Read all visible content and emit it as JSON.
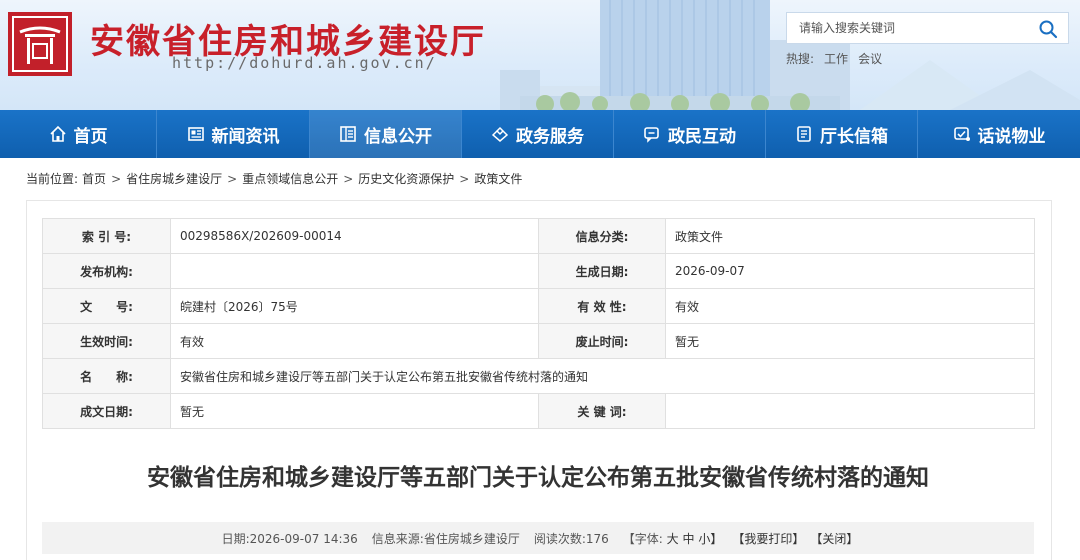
{
  "header": {
    "site_title": "安徽省住房和城乡建设厅",
    "site_url": "http://dohurd.ah.gov.cn/",
    "search_placeholder": "请输入搜索关键词",
    "hot_search_label": "热搜:",
    "hot_search_items": [
      "工作",
      "会议"
    ]
  },
  "nav": {
    "items": [
      {
        "label": "首页",
        "icon": "home-icon"
      },
      {
        "label": "新闻资讯",
        "icon": "news-icon"
      },
      {
        "label": "信息公开",
        "icon": "document-icon"
      },
      {
        "label": "政务服务",
        "icon": "service-icon"
      },
      {
        "label": "政民互动",
        "icon": "chat-icon"
      },
      {
        "label": "厅长信箱",
        "icon": "mailbox-icon"
      },
      {
        "label": "话说物业",
        "icon": "property-icon"
      }
    ],
    "active_index": 2
  },
  "breadcrumb": {
    "label": "当前位置:",
    "items": [
      "首页",
      "省住房城乡建设厅",
      "重点领域信息公开",
      "历史文化资源保护",
      "政策文件"
    ]
  },
  "info_table": {
    "rows": [
      {
        "k1": "索 引 号:",
        "v1": "00298586X/202609-00014",
        "k2": "信息分类:",
        "v2": "政策文件"
      },
      {
        "k1": "发布机构:",
        "v1": "",
        "k2": "生成日期:",
        "v2": "2026-09-07"
      },
      {
        "k1": "文　　号:",
        "v1": "皖建村〔2026〕75号",
        "k2": "有 效 性:",
        "v2": "有效"
      },
      {
        "k1": "生效时间:",
        "v1": "有效",
        "k2": "废止时间:",
        "v2": "暂无"
      },
      {
        "k1": "名　　称:",
        "v1": "安徽省住房和城乡建设厅等五部门关于认定公布第五批安徽省传统村落的通知"
      },
      {
        "k1": "成文日期:",
        "v1": "暂无",
        "k2": "关 键 词:",
        "v2": ""
      }
    ]
  },
  "article": {
    "title": "安徽省住房和城乡建设厅等五部门关于认定公布第五批安徽省传统村落的通知",
    "date_label": "日期:",
    "date": "2026-09-07 14:36",
    "source_label": "信息来源:",
    "source": "省住房城乡建设厅",
    "views_label": "阅读次数:",
    "views": "176",
    "font_label": "【字体:",
    "font_large": "大",
    "font_medium": "中",
    "font_small": "小】",
    "print_label": "【我要打印】",
    "close_label": "【关闭】"
  },
  "colors": {
    "brand_red": "#c8202a",
    "nav_blue": "#1a73c8",
    "table_key_bg": "#f6f6f6"
  }
}
